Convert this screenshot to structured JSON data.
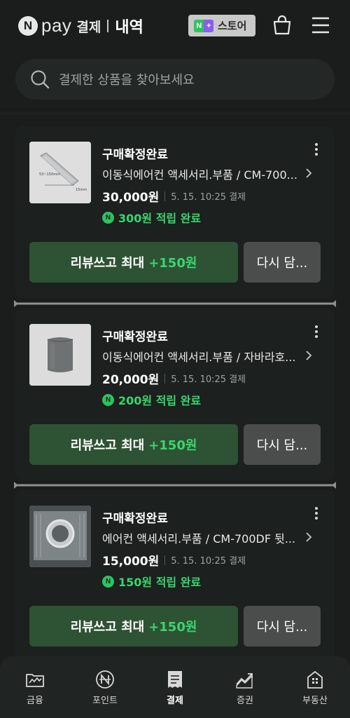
{
  "header": {
    "logo_letter": "N",
    "logo_pay": "pay",
    "logo_gyeolje": "결제",
    "title": "내역",
    "store_badge_n": "N",
    "store_badge_plus": "+",
    "store_label": "스토어"
  },
  "search": {
    "placeholder": "결제한 상품을 찾아보세요"
  },
  "orders": [
    {
      "status": "구매확정완료",
      "product": "이동식에어컨 액세서리.부품 / CM-700...",
      "price": "30,000원",
      "date": "5. 15. 10:25 결제",
      "points": "300원 적립 완료",
      "review_label": "리뷰쓰고 최대",
      "review_points": "+150원",
      "again_label": "다시 담..."
    },
    {
      "status": "구매확정완료",
      "product": "이동식에어컨 액세서리.부품 / 자바라호...",
      "price": "20,000원",
      "date": "5. 15. 10:25 결제",
      "points": "200원 적립 완료",
      "review_label": "리뷰쓰고 최대",
      "review_points": "+150원",
      "again_label": "다시 담..."
    },
    {
      "status": "구매확정완료",
      "product": "에어컨 액세서리.부품 / CM-700DF 뒷...",
      "price": "15,000원",
      "date": "5. 15. 10:25 결제",
      "points": "150원 적립 완료",
      "review_label": "리뷰쓰고 최대",
      "review_points": "+150원",
      "again_label": "다시 담..."
    }
  ],
  "product_images": {
    "image1_caption_a": "53~150mm",
    "image1_caption_b": "15mm"
  },
  "points_badge": "N",
  "bottom_nav": [
    {
      "label": "금융",
      "icon": "finance-icon"
    },
    {
      "label": "포인트",
      "icon": "points-icon"
    },
    {
      "label": "결제",
      "icon": "receipt-icon",
      "active": true
    },
    {
      "label": "증권",
      "icon": "stock-chart-icon"
    },
    {
      "label": "부동산",
      "icon": "building-icon"
    }
  ],
  "colors": {
    "background": "#1a1d1c",
    "accent_green": "#3ad56d",
    "review_button": "#2e5234",
    "again_button": "#4a4d4c"
  }
}
